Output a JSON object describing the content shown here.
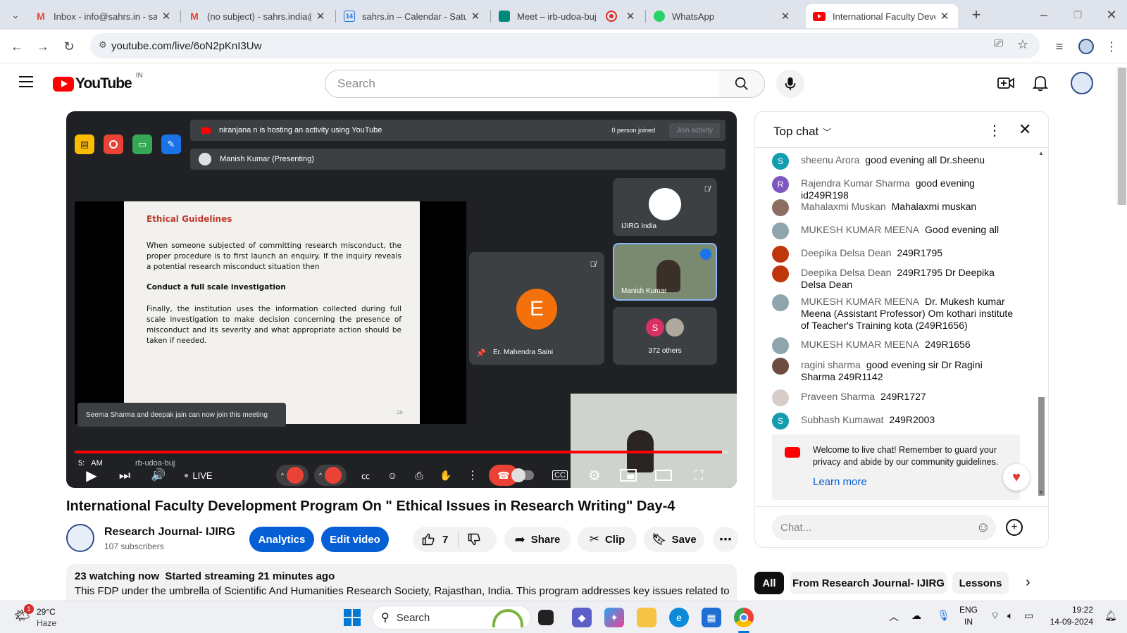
{
  "tabs": [
    {
      "label": "Inbox - info@sahrs.in - sah",
      "icon": "gmail-icon"
    },
    {
      "label": "(no subject) - sahrs.india@",
      "icon": "gmail-icon"
    },
    {
      "label": "sahrs.in – Calendar - Saturd",
      "icon": "calendar-icon",
      "badge": "14"
    },
    {
      "label": "Meet – irb-udoa-buj",
      "icon": "meet-icon"
    },
    {
      "label": "WhatsApp",
      "icon": "whatsapp-icon"
    },
    {
      "label": "International Faculty Devel",
      "icon": "youtube-icon"
    }
  ],
  "address": {
    "url": "youtube.com/live/6oN2pKnI3Uw"
  },
  "youtube": {
    "country": "IN",
    "search_placeholder": "Search",
    "logo_text": "YouTube"
  },
  "meet": {
    "activity_text": "niranjana n is hosting an activity using YouTube",
    "person_joined": "0 person joined",
    "join_activity": "Join activity",
    "presenting": "Manish Kumar (Presenting)",
    "tile_ijirg": "IJIRG India",
    "tile_manish": "Manish Kumar",
    "tile_mahendra": "Er. Mahendra Saini",
    "tile_mahendra_initial": "E",
    "others_initial": "S",
    "others_count": "372 others",
    "toast": "Seema Sharma and deepak jain can now join this meeting",
    "time_code": "5:",
    "time_code_suffix": "AM",
    "meeting_code": "rb-udoa-buj"
  },
  "slide": {
    "title": "Ethical Guidelines",
    "p1": "When someone subjected of committing research misconduct, the proper procedure is to first launch an enquiry. If the inquiry reveals a potential research misconduct situation then",
    "heading2": "Conduct a full scale investigation",
    "p2": "Finally, the institution uses the information collected during full scale investigation to make decision concerning the presence of misconduct and its severity and what appropriate action should be taken if needed.",
    "page_no": "20"
  },
  "player": {
    "live_label": "LIVE",
    "progress": 0.99
  },
  "video": {
    "title": "International Faculty Development Program On \" Ethical Issues in Research Writing\" Day-4",
    "channel": "Research Journal- IJIRG",
    "subscribers": "107 subscribers",
    "analytics": "Analytics",
    "edit_video": "Edit video",
    "likes": "7",
    "share": "Share",
    "clip": "Clip",
    "save": "Save",
    "watching": "23 watching now",
    "started": "Started streaming 21 minutes ago",
    "description": "This FDP under the umbrella of Scientific And Humanities Research Society, Rajasthan, India. This program addresses key issues related to"
  },
  "chat": {
    "header": "Top chat",
    "messages": [
      {
        "author": "sheenu Arora",
        "text": "good evening all Dr.sheenu",
        "initial": "S",
        "color": "#129eaf"
      },
      {
        "author": "Rajendra Kumar Sharma",
        "text": "good evening id249R198",
        "initial": "R",
        "color": "#7e57c2"
      },
      {
        "author": "Mahalaxmi Muskan",
        "text": "Mahalaxmi muskan",
        "initial": "",
        "color": "#8d6e63"
      },
      {
        "author": "MUKESH KUMAR MEENA",
        "text": "Good evening all",
        "initial": "",
        "color": "#90a4ae"
      },
      {
        "author": "Deepika Delsa Dean",
        "text": "249R1795",
        "initial": "",
        "color": "#bf360c"
      },
      {
        "author": "Deepika Delsa Dean",
        "text": "249R1795 Dr Deepika Delsa Dean",
        "initial": "",
        "color": "#bf360c"
      },
      {
        "author": "MUKESH KUMAR MEENA",
        "text": "Dr. Mukesh kumar Meena (Assistant Professor) Om kothari institute of Teacher's Training kota (249R1656)",
        "initial": "",
        "color": "#90a4ae"
      },
      {
        "author": "MUKESH KUMAR MEENA",
        "text": "249R1656",
        "initial": "",
        "color": "#90a4ae"
      },
      {
        "author": "ragini sharma",
        "text": "good evening sir Dr Ragini Sharma 249R1142",
        "initial": "",
        "color": "#6d4c41"
      },
      {
        "author": "Praveen Sharma",
        "text": "249R1727",
        "initial": "",
        "color": "#d7ccc8"
      },
      {
        "author": "Subhash Kumawat",
        "text": "249R2003",
        "initial": "S",
        "color": "#129eaf"
      }
    ],
    "welcome": "Welcome to live chat! Remember to guard your privacy and abide by our community guidelines.",
    "learn_more": "Learn more",
    "input_placeholder": "Chat..."
  },
  "chips": [
    "All",
    "From Research Journal- IJIRG",
    "Lessons"
  ],
  "taskbar": {
    "temp": "29°C",
    "weather": "Haze",
    "weather_badge": "1",
    "search": "Search",
    "lang1": "ENG",
    "lang2": "IN",
    "time": "19:22",
    "date": "14-09-2024"
  }
}
